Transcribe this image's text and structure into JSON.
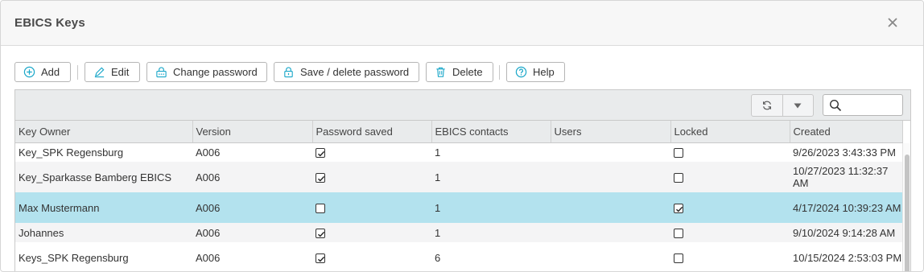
{
  "dialog": {
    "title": "EBICS Keys"
  },
  "toolbar": {
    "add": "Add",
    "edit": "Edit",
    "change_password": "Change password",
    "save_delete_password": "Save / delete password",
    "delete": "Delete",
    "help": "Help"
  },
  "search": {
    "value": ""
  },
  "table": {
    "columns": [
      "Key Owner",
      "Version",
      "Password saved",
      "EBICS contacts",
      "Users",
      "Locked",
      "Created"
    ],
    "rows": [
      {
        "owner": "Key_SPK Regensburg",
        "version": "A006",
        "password_saved": true,
        "contacts": "1",
        "users": "",
        "locked": false,
        "created": "9/26/2023 3:43:33 PM"
      },
      {
        "owner": "Key_Sparkasse Bamberg EBICS",
        "version": "A006",
        "password_saved": true,
        "contacts": "1",
        "users": "",
        "locked": false,
        "created": "10/27/2023 11:32:37 AM"
      },
      {
        "owner": "Max Mustermann",
        "version": "A006",
        "password_saved": false,
        "contacts": "1",
        "users": "",
        "locked": true,
        "created": "4/17/2024 10:39:23 AM",
        "selected": true
      },
      {
        "owner": "Johannes",
        "version": "A006",
        "password_saved": true,
        "contacts": "1",
        "users": "",
        "locked": false,
        "created": "9/10/2024 9:14:28 AM"
      },
      {
        "owner": "Keys_SPK Regensburg",
        "version": "A006",
        "password_saved": true,
        "contacts": "6",
        "users": "",
        "locked": false,
        "created": "10/15/2024 2:53:03 PM"
      }
    ]
  },
  "colors": {
    "accent": "#1aa7c9",
    "selected_row": "#b3e2ee"
  }
}
